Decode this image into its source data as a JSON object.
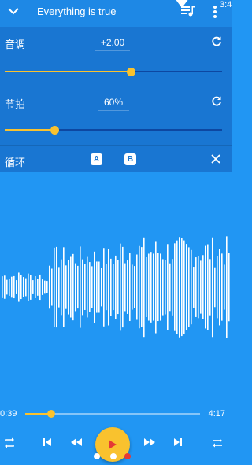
{
  "header": {
    "title": "Everything is true",
    "status_time": "3:4"
  },
  "pitch": {
    "label": "音调",
    "value": "+2.00",
    "level_fraction": 0.58
  },
  "tempo": {
    "label": "节拍",
    "value": "60%",
    "level_fraction": 0.23
  },
  "loop": {
    "label": "循环",
    "a_label": "A",
    "b_label": "B"
  },
  "playback": {
    "current_time": "0:39",
    "total_time": "4:17",
    "progress_fraction": 0.15
  },
  "icons": [
    "chevron-down-icon",
    "queue-music-icon",
    "more-vert-icon",
    "reset-icon",
    "close-icon",
    "repeat-icon",
    "skip-previous-icon",
    "rewind-icon",
    "play-icon",
    "fast-forward-icon",
    "skip-next-icon",
    "shuffle-icon"
  ],
  "colors": {
    "accent": "#F9C22E",
    "background": "#2196F3",
    "panel": "#1976D2",
    "toolbar": "#1E88E5",
    "page_dot_active": "#E53935"
  }
}
